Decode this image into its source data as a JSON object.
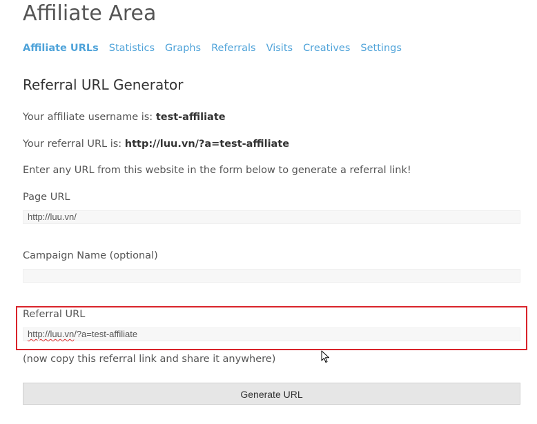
{
  "page": {
    "title": "Affiliate Area"
  },
  "tabs": [
    {
      "label": "Affiliate URLs",
      "active": true
    },
    {
      "label": "Statistics",
      "active": false
    },
    {
      "label": "Graphs",
      "active": false
    },
    {
      "label": "Referrals",
      "active": false
    },
    {
      "label": "Visits",
      "active": false
    },
    {
      "label": "Creatives",
      "active": false
    },
    {
      "label": "Settings",
      "active": false
    }
  ],
  "generator": {
    "heading": "Referral URL Generator",
    "username_prefix": "Your affiliate username is: ",
    "username": "test-affiliate",
    "referral_prefix": "Your referral URL is: ",
    "referral_url": "http://luu.vn/?a=test-affiliate",
    "instructions": "Enter any URL from this website in the form below to generate a referral link!",
    "page_url_label": "Page URL",
    "page_url_value": "http://luu.vn/",
    "campaign_label": "Campaign Name (optional)",
    "campaign_value": "",
    "referral_url_label": "Referral URL",
    "referral_url_value_part1": "http://luu.vn",
    "referral_url_value_part2": "/?a=test-affiliate",
    "copy_note": "(now copy this referral link and share it anywhere)",
    "button_label": "Generate URL"
  },
  "colors": {
    "link": "#4fa3d9",
    "highlight": "#d9232a"
  }
}
